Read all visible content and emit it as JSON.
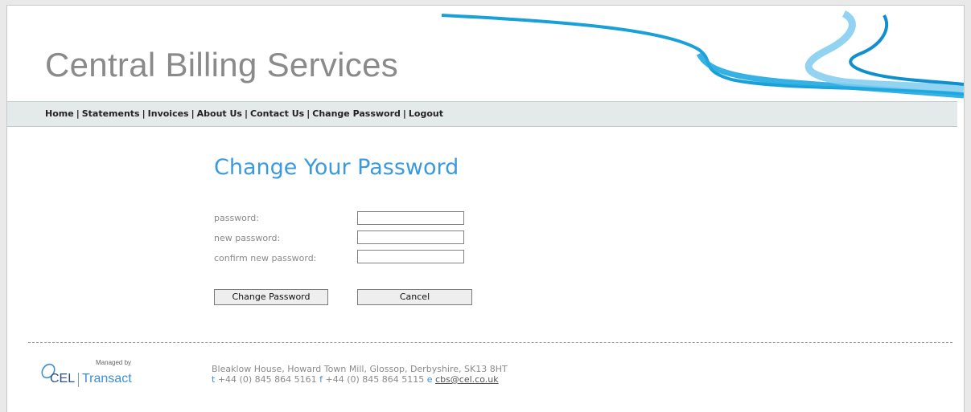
{
  "header": {
    "site_title": "Central Billing Services"
  },
  "nav": {
    "items": [
      {
        "label": "Home"
      },
      {
        "label": "Statements"
      },
      {
        "label": "Invoices"
      },
      {
        "label": "About Us"
      },
      {
        "label": "Contact Us"
      },
      {
        "label": "Change Password"
      },
      {
        "label": "Logout"
      }
    ],
    "separator": "|"
  },
  "form": {
    "heading": "Change Your Password",
    "fields": [
      {
        "label": "password:",
        "value": ""
      },
      {
        "label": "new password:",
        "value": ""
      },
      {
        "label": "confirm new password:",
        "value": ""
      }
    ],
    "submit_label": "Change Password",
    "cancel_label": "Cancel"
  },
  "footer": {
    "logo": {
      "managed_by": "Managed by",
      "brand_left": "CEL",
      "brand_right": "Transact"
    },
    "address": "Bleaklow House, Howard Town Mill, Glossop, Derbyshire, SK13 8HT",
    "phone_prefix": "t",
    "phone": "+44 (0) 845 864 5161",
    "fax_prefix": "f",
    "fax": "+44 (0) 845 864 5115",
    "email_prefix": "e",
    "email": "cbs@cel.co.uk"
  },
  "colors": {
    "accent": "#3a9ae0",
    "nav_background": "#e4e9ea",
    "ribbon": "#1fa3d8"
  }
}
